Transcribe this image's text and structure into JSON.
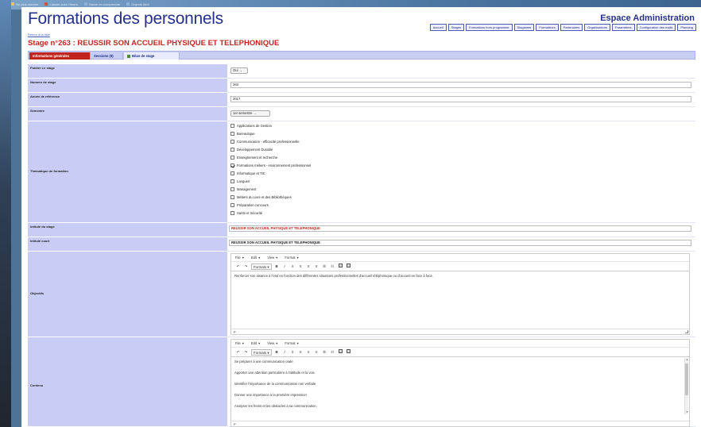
{
  "browser": {
    "bookmarks": [
      "Ne plus montrer",
      "Laisser avec l'heure",
      "Savoir en comprendre",
      "Objects html"
    ]
  },
  "header": {
    "title": "Formations des personnels",
    "espace": "Espace Administration",
    "nav": [
      "Accueil",
      "Stages",
      "Formations hors programme",
      "Stagiaires",
      "Formateurs",
      "Partenaires",
      "Organisations",
      "Paramètres",
      "Configuration des mails",
      "Planning"
    ]
  },
  "back_link": "Retour à la liste",
  "stage_title": "Stage n°263 : REUSSIR SON ACCUEIL PHYSIQUE ET TELEPHONIQUE",
  "tabs": [
    "Informations générales",
    "Sessions (9)",
    "Bilan de stage"
  ],
  "form": {
    "publier": {
      "label": "Publier Le stage",
      "value": "Oui"
    },
    "numero": {
      "label": "Numero de stage",
      "value": "263"
    },
    "annee": {
      "label": "Année de référence",
      "value": "2017"
    },
    "semestre": {
      "label": "Semestre",
      "value": "1er semestre"
    },
    "thematique": {
      "label": "Thématique de formation",
      "options": [
        {
          "label": "Applications de Gestion",
          "checked": false
        },
        {
          "label": "Bureautique",
          "checked": false
        },
        {
          "label": "Communication - efficacité professionnelle",
          "checked": false
        },
        {
          "label": "Développement Durable",
          "checked": false
        },
        {
          "label": "Enseignement et recherche",
          "checked": false
        },
        {
          "label": "Formations métiers - environnement professionnel",
          "checked": true
        },
        {
          "label": "Informatique et TIC",
          "checked": false
        },
        {
          "label": "Langues",
          "checked": false
        },
        {
          "label": "Management",
          "checked": false
        },
        {
          "label": "Métiers du Livre et des Bibliothèques",
          "checked": false
        },
        {
          "label": "Préparation concours",
          "checked": false
        },
        {
          "label": "Santé et Sécurité",
          "checked": false
        }
      ]
    },
    "intitule_stage": {
      "label": "Intitulé du stage",
      "value": "REUSSIR SON ACCUEIL PHYSIQUE ET TELEPHONIQUE"
    },
    "intitule_court": {
      "label": "Intitulé court",
      "value": "REUSSIR SON ACCUEIL PHYSIQUE ET TELEPHONIQUE"
    },
    "objectifs": {
      "label": "Objectifs",
      "text": "Renforcer son aisance à l'oral en fonction des différentes situations professionnelles d'accueil téléphonique ou d'accueil en face à face.",
      "status": "P"
    },
    "contenu": {
      "label": "Contenu",
      "lines": [
        "Se préparer à une communication orale",
        "Apporter une attention particulière à l'attitude et la voix",
        "Identifier l'importance de la communication non verbale",
        "Donner une importance à la première impression",
        "Analyser les freins et les obstacles à sa communication."
      ],
      "status": "P"
    }
  },
  "editor": {
    "menus": [
      "File",
      "Edit",
      "View",
      "Format"
    ],
    "formats_label": "Formats",
    "bold": "B",
    "italic": "I"
  }
}
